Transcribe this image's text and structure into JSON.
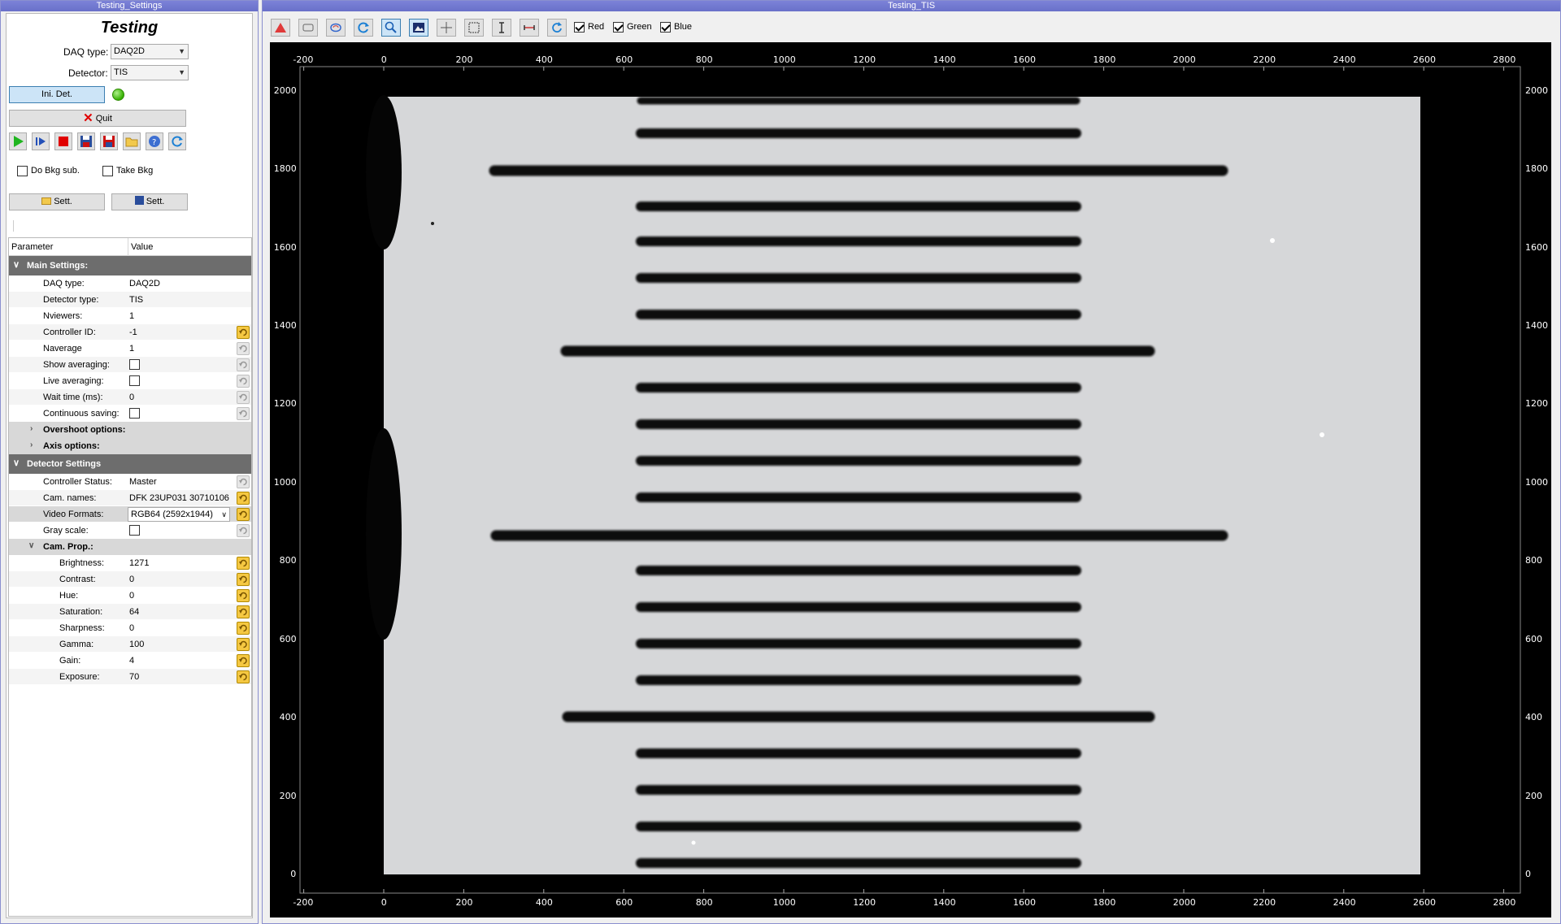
{
  "settings_window": {
    "title": "Testing_Settings",
    "app_title": "Testing",
    "daq_type_label": "DAQ type:",
    "daq_type_value": "DAQ2D",
    "detector_label": "Detector:",
    "detector_value": "TIS",
    "ini_det_label": "Ini. Det.",
    "quit_label": "Quit",
    "do_bkg_label": "Do Bkg sub.",
    "take_bkg_label": "Take Bkg",
    "load_settings_label": "Sett.",
    "save_settings_label": "Sett.",
    "status_color": "#35b000"
  },
  "tree": {
    "col_parameter": "Parameter",
    "col_value": "Value",
    "main_group": "Main Settings:",
    "main_rows": [
      {
        "name": "DAQ type:",
        "value": "DAQ2D"
      },
      {
        "name": "Detector type:",
        "value": "TIS"
      },
      {
        "name": "Nviewers:",
        "value": "1"
      },
      {
        "name": "Controller ID:",
        "value": "-1"
      },
      {
        "name": "Naverage",
        "value": "1"
      },
      {
        "name": "Show averaging:",
        "value": ""
      },
      {
        "name": "Live averaging:",
        "value": ""
      },
      {
        "name": "Wait time (ms):",
        "value": "0"
      },
      {
        "name": "Continuous saving:",
        "value": ""
      }
    ],
    "overshoot": "Overshoot options:",
    "axis": "Axis options:",
    "detector_group": "Detector Settings",
    "det_rows": [
      {
        "name": "Controller Status:",
        "value": "Master"
      },
      {
        "name": "Cam. names:",
        "value": "DFK 23UP031 30710106"
      },
      {
        "name": "Video Formats:",
        "value": "RGB64 (2592x1944)"
      },
      {
        "name": "Gray scale:",
        "value": ""
      }
    ],
    "cam_prop": "Cam. Prop.:",
    "cam_rows": [
      {
        "name": "Brightness:",
        "value": "1271"
      },
      {
        "name": "Contrast:",
        "value": "0"
      },
      {
        "name": "Hue:",
        "value": "0"
      },
      {
        "name": "Saturation:",
        "value": "64"
      },
      {
        "name": "Sharpness:",
        "value": "0"
      },
      {
        "name": "Gamma:",
        "value": "100"
      },
      {
        "name": "Gain:",
        "value": "4"
      },
      {
        "name": "Exposure:",
        "value": "70"
      }
    ]
  },
  "viewer_window": {
    "title": "Testing_TIS",
    "red_label": "Red",
    "green_label": "Green",
    "blue_label": "Blue",
    "x_ticks": [
      "-200",
      "0",
      "200",
      "400",
      "600",
      "800",
      "1000",
      "1200",
      "1400",
      "1600",
      "1800",
      "2000",
      "2200",
      "2400",
      "2600",
      "2800"
    ],
    "y_ticks": [
      "2000",
      "1800",
      "1600",
      "1400",
      "1200",
      "1000",
      "800",
      "600",
      "400",
      "200",
      "0"
    ]
  },
  "colors": {
    "title_bar": "#6970c9",
    "group_header": "#6d6d6d",
    "active_tool": "#cce4f7",
    "image_bg": "#cfd8d6"
  }
}
